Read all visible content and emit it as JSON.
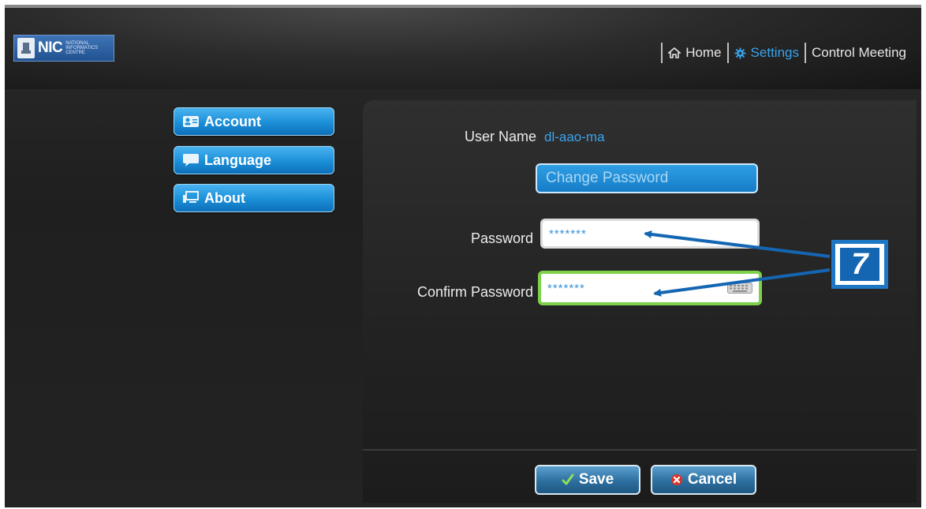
{
  "header": {
    "logo_text": "NIC",
    "logo_subtext": [
      "NATIONAL",
      "INFORMATICS",
      "CENTRE"
    ],
    "nav": [
      {
        "label": "Home",
        "icon": "home-icon",
        "active": false
      },
      {
        "label": "Settings",
        "icon": "gear-icon",
        "active": true
      },
      {
        "label": "Control Meeting",
        "icon": null,
        "active": false
      }
    ]
  },
  "sidebar": {
    "items": [
      {
        "label": "Account",
        "icon": "account-card-icon"
      },
      {
        "label": "Language",
        "icon": "speech-bubble-icon"
      },
      {
        "label": "About",
        "icon": "monitor-icon"
      }
    ]
  },
  "account": {
    "username_label": "User Name",
    "username_value": "dl-aao-ma",
    "change_password_label": "Change Password",
    "password_label": "Password",
    "password_value": "*******",
    "confirm_password_label": "Confirm Password",
    "confirm_password_value": "*******"
  },
  "annotation": {
    "callout_number": "7"
  },
  "footer": {
    "save_label": "Save",
    "cancel_label": "Cancel"
  },
  "colors": {
    "accent": "#3aa3ec",
    "button_blue": "#1b8fd8",
    "focus_green": "#7ed14a",
    "callout_blue": "#1466b3"
  }
}
